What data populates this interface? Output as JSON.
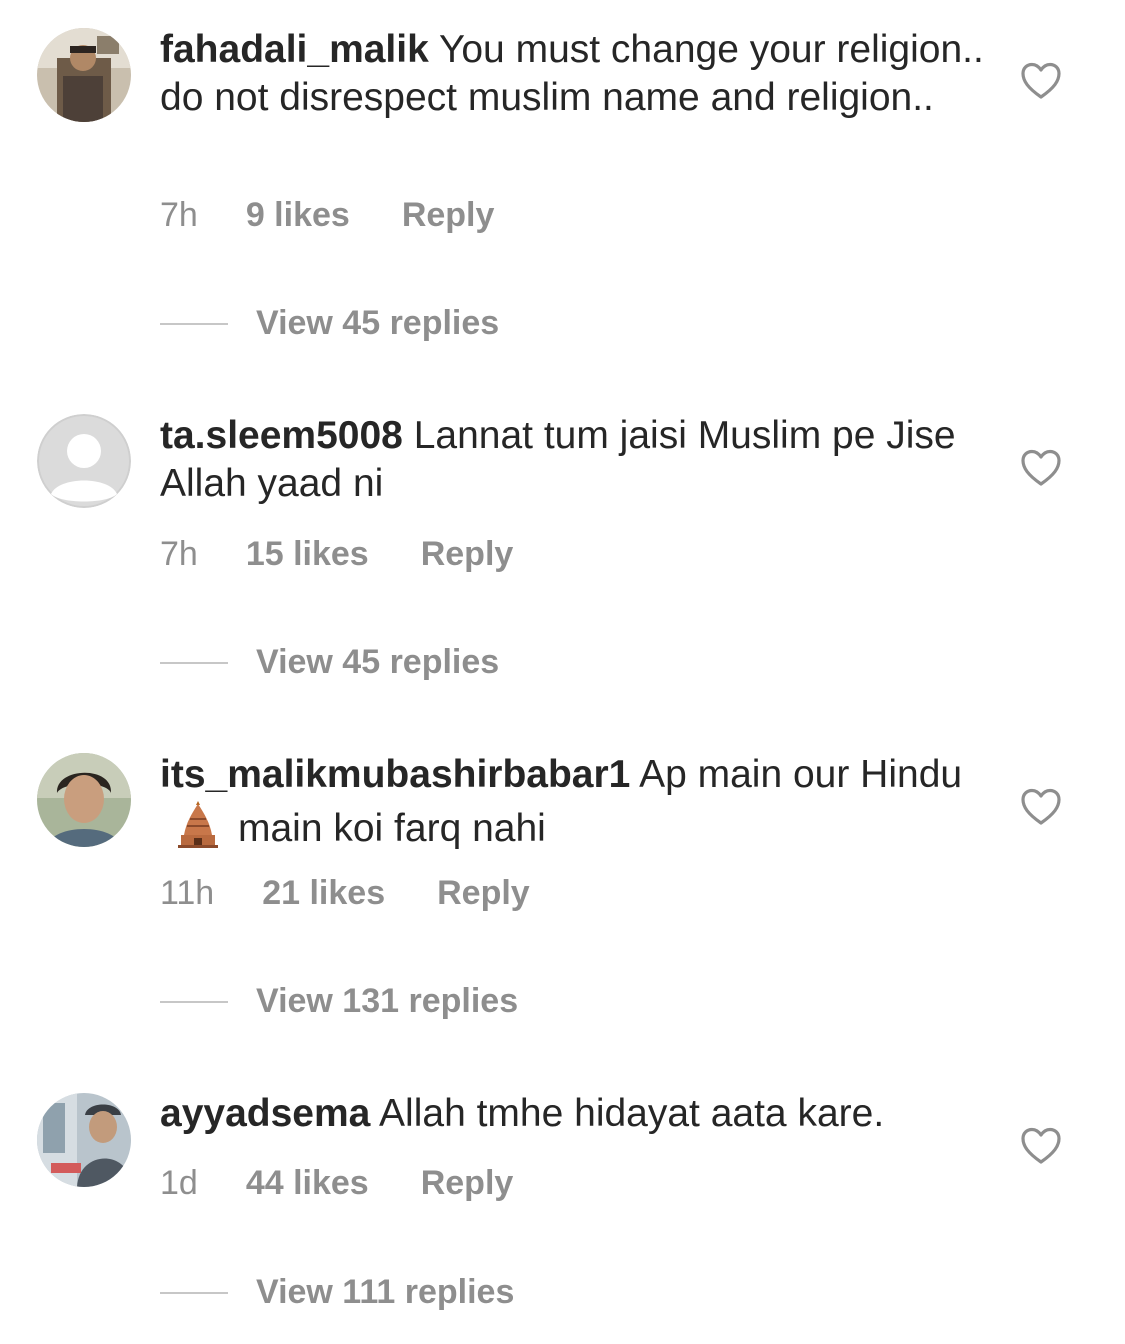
{
  "comments": [
    {
      "username": "fahadali_malik",
      "text": "You must change your religion.. do not disrespect muslim name and religion..",
      "time": "7h",
      "likes": "9 likes",
      "reply": "Reply",
      "view_replies": "View 45 replies"
    },
    {
      "username": "ta.sleem5008",
      "text": "Lannat tum jaisi Muslim pe Jise Allah yaad ni",
      "time": "7h",
      "likes": "15 likes",
      "reply": "Reply",
      "view_replies": "View 45 replies"
    },
    {
      "username": "its_malikmubashirbabar1",
      "text_before_emoji": "Ap main our Hindu",
      "emoji": "hindu-temple",
      "text_after_emoji": "main koi farq nahi",
      "time": "11h",
      "likes": "21 likes",
      "reply": "Reply",
      "view_replies": "View 131 replies"
    },
    {
      "username": "ayyadsema",
      "text": "Allah tmhe hidayat aata kare.",
      "time": "1d",
      "likes": "44 likes",
      "reply": "Reply",
      "view_replies": "View 111 replies"
    }
  ],
  "colors": {
    "text_primary": "#262626",
    "text_secondary": "#8e8e8e",
    "divider": "#c7c7c7",
    "heart_outline": "#8e8e8e"
  },
  "icons": {
    "like": "heart-outline-icon",
    "avatar_placeholder": "default-avatar-icon"
  }
}
